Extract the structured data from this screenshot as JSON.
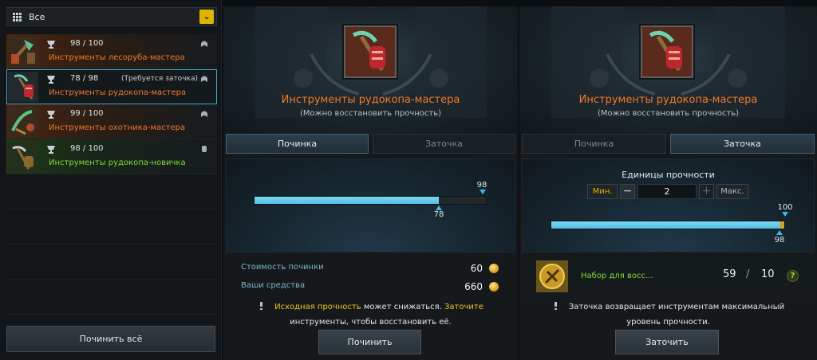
{
  "filter": {
    "label": "Все",
    "icon": "grid-icon",
    "chevron": "chevron-down-icon"
  },
  "items": [
    {
      "durability": "98 / 100",
      "note": "",
      "name": "Инструменты лесоруба-мастера",
      "rarity": "orange",
      "selected": false
    },
    {
      "durability": "78 / 98",
      "note": "(Требуется заточка)",
      "name": "Инструменты рудокопа-мастера",
      "rarity": "orange",
      "selected": true
    },
    {
      "durability": "99 / 100",
      "note": "",
      "name": "Инструменты охотника-мастера",
      "rarity": "orange",
      "selected": false
    },
    {
      "durability": "98 / 100",
      "note": "",
      "name": "Инструменты рудокопа-новичка",
      "rarity": "green",
      "selected": false
    }
  ],
  "repair_all_label": "Починить всё",
  "repair": {
    "title": "Инструменты рудокопа-мастера",
    "subtitle": "(Можно восстановить прочность)",
    "tabs": [
      "Починка",
      "Заточка"
    ],
    "bar": {
      "current": 78,
      "max": 98,
      "current_label": "78",
      "max_label": "98"
    },
    "cost_label": "Стоимость починки",
    "cost_value": "60",
    "funds_label": "Ваши средства",
    "funds_value": "660",
    "warn_hl1": "Исходная прочность",
    "warn_mid": " может снижаться. ",
    "warn_hl2": "Заточите",
    "warn_line2": "инструменты, чтобы восстановить её.",
    "button": "Починить"
  },
  "sharpen": {
    "title": "Инструменты рудокопа-мастера",
    "subtitle": "(Можно восстановить прочность)",
    "tabs": [
      "Починка",
      "Заточка"
    ],
    "units_title": "Единицы прочности",
    "min_label": "Мин.",
    "max_label": "Макс.",
    "stepper_value": "2",
    "bar": {
      "current": 98,
      "max": 100,
      "current_label": "98",
      "max_label": "100"
    },
    "kit_name": "Набор для восс...",
    "kit_have": "59",
    "kit_sep": "/",
    "kit_need": "10",
    "help": "?",
    "warn_line1": "Заточка возвращает инструментам максимальный",
    "warn_line2": "уровень прочности.",
    "button": "Заточить"
  },
  "colors": {
    "rarity_orange": "#f07a2a",
    "rarity_green": "#7fdc3c",
    "highlight": "#f2c21c",
    "bar_fill": "#4fbfe4",
    "accent_gold": "#e0b200"
  }
}
